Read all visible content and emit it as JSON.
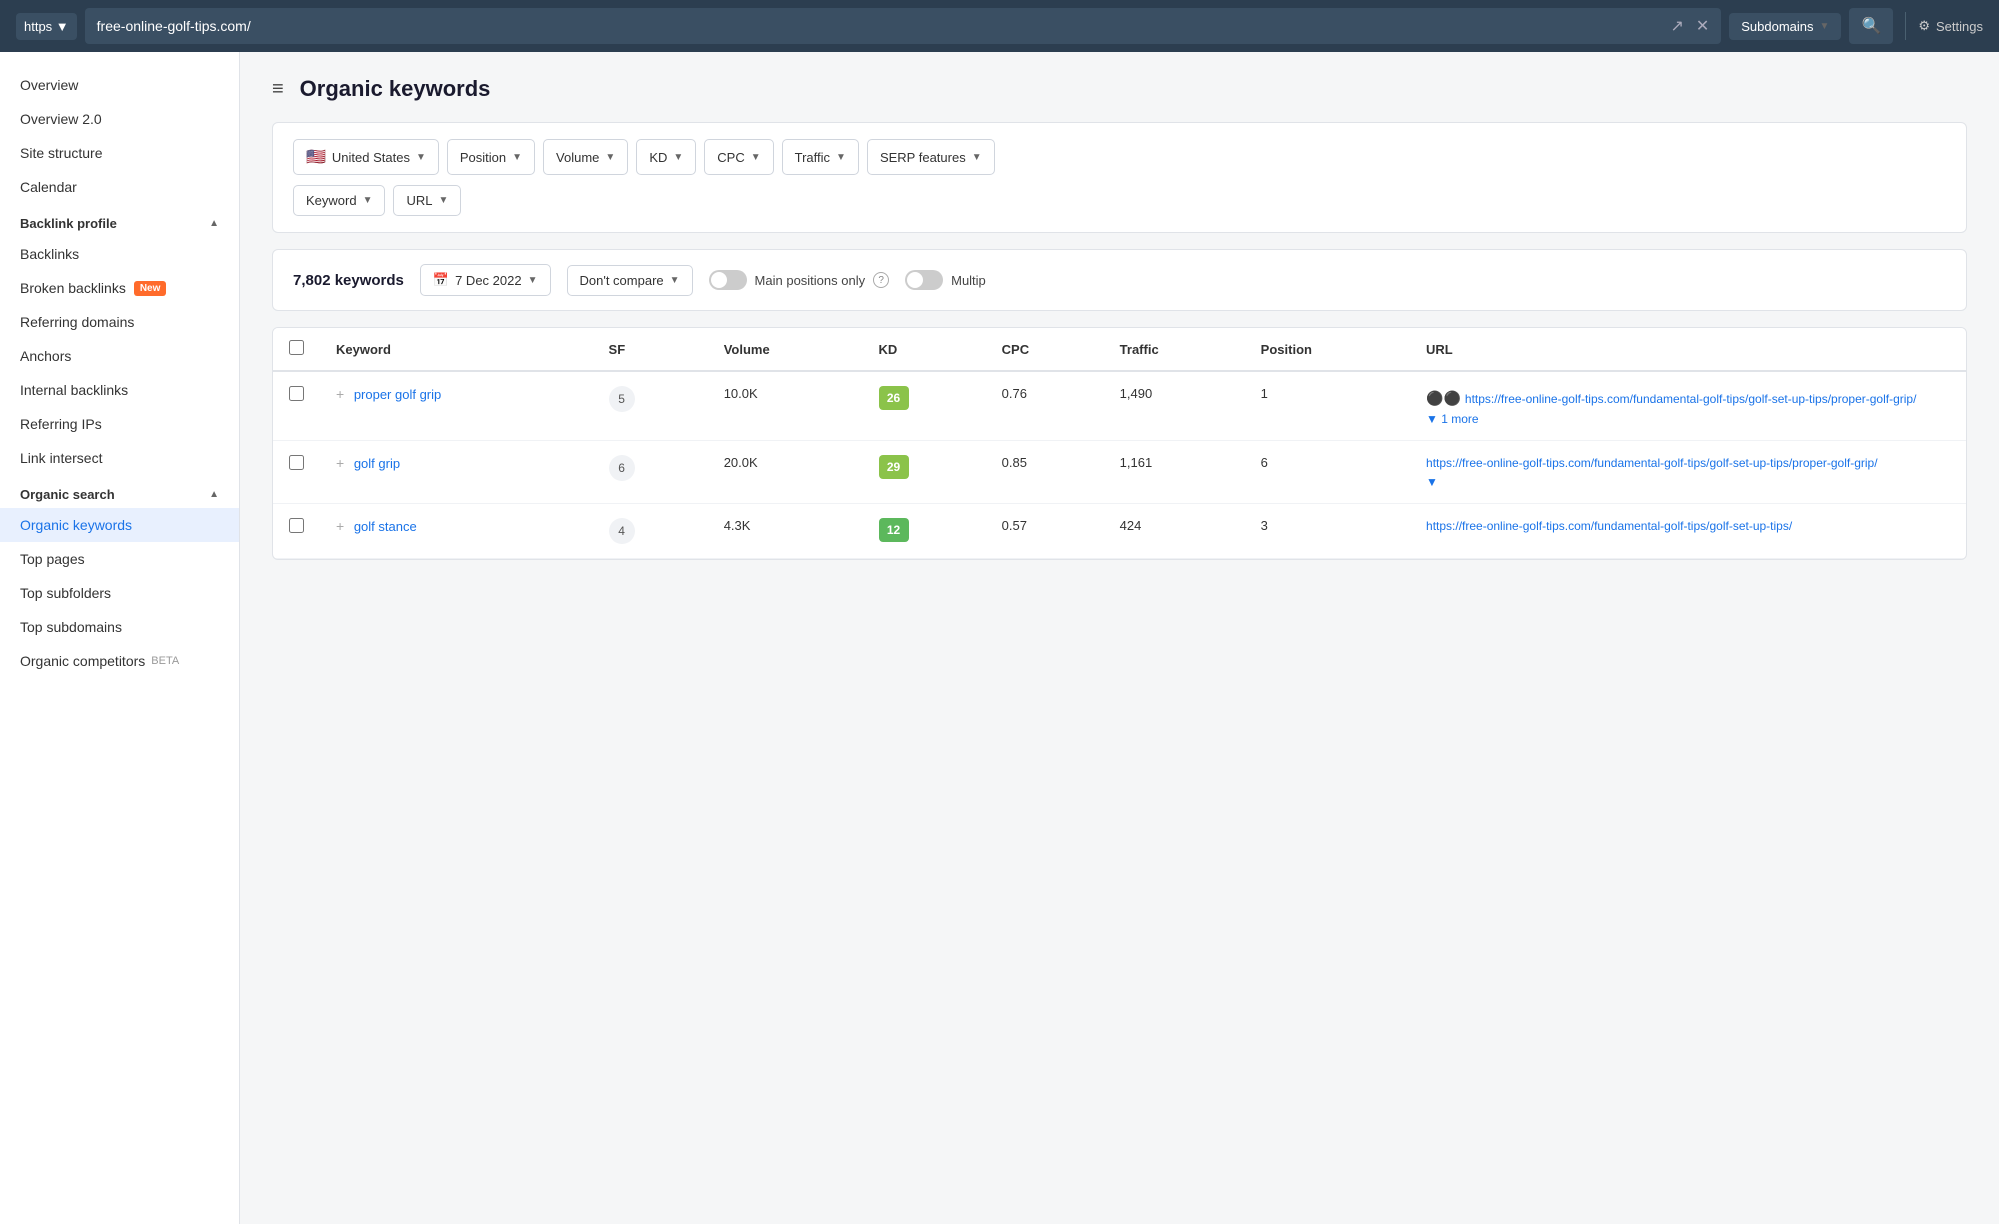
{
  "topbar": {
    "protocol": "https",
    "protocol_label": "https ▼",
    "url": "free-online-golf-tips.com/",
    "external_icon": "↗",
    "close_icon": "✕",
    "subdomain_label": "Subdomains",
    "search_icon": "🔍",
    "settings_label": "Settings"
  },
  "sidebar": {
    "top_items": [
      {
        "id": "overview",
        "label": "Overview"
      },
      {
        "id": "overview-2",
        "label": "Overview 2.0"
      },
      {
        "id": "site-structure",
        "label": "Site structure"
      },
      {
        "id": "calendar",
        "label": "Calendar"
      }
    ],
    "sections": [
      {
        "id": "backlink-profile",
        "label": "Backlink profile",
        "expanded": true,
        "items": [
          {
            "id": "backlinks",
            "label": "Backlinks",
            "badge": null
          },
          {
            "id": "broken-backlinks",
            "label": "Broken backlinks",
            "badge": "New"
          },
          {
            "id": "referring-domains",
            "label": "Referring domains",
            "badge": null
          },
          {
            "id": "anchors",
            "label": "Anchors",
            "badge": null
          },
          {
            "id": "internal-backlinks",
            "label": "Internal backlinks",
            "badge": null
          },
          {
            "id": "referring-ips",
            "label": "Referring IPs",
            "badge": null
          },
          {
            "id": "link-intersect",
            "label": "Link intersect",
            "badge": null
          }
        ]
      },
      {
        "id": "organic-search",
        "label": "Organic search",
        "expanded": true,
        "items": [
          {
            "id": "organic-keywords",
            "label": "Organic keywords",
            "badge": null,
            "active": true
          },
          {
            "id": "top-pages",
            "label": "Top pages",
            "badge": null
          },
          {
            "id": "top-subfolders",
            "label": "Top subfolders",
            "badge": null
          },
          {
            "id": "top-subdomains",
            "label": "Top subdomains",
            "badge": null
          },
          {
            "id": "organic-competitors",
            "label": "Organic competitors",
            "badge": "BETA"
          }
        ]
      }
    ]
  },
  "page": {
    "menu_icon": "≡",
    "title": "Organic keywords"
  },
  "filters": {
    "row1": [
      {
        "id": "country",
        "flag": "🇺🇸",
        "label": "United States",
        "has_dropdown": true
      },
      {
        "id": "position",
        "label": "Position",
        "has_dropdown": true
      },
      {
        "id": "volume",
        "label": "Volume",
        "has_dropdown": true
      },
      {
        "id": "kd",
        "label": "KD",
        "has_dropdown": true
      },
      {
        "id": "cpc",
        "label": "CPC",
        "has_dropdown": true
      },
      {
        "id": "traffic",
        "label": "Traffic",
        "has_dropdown": true
      },
      {
        "id": "serp-features",
        "label": "SERP features",
        "has_dropdown": true
      }
    ],
    "row2": [
      {
        "id": "keyword",
        "label": "Keyword",
        "has_dropdown": true
      },
      {
        "id": "url",
        "label": "URL",
        "has_dropdown": true
      }
    ]
  },
  "toolbar": {
    "keywords_count": "7,802 keywords",
    "date_icon": "📅",
    "date_label": "7 Dec 2022",
    "compare_label": "Don't compare",
    "main_positions_label": "Main positions only",
    "multi_label": "Multip"
  },
  "table": {
    "columns": [
      {
        "id": "checkbox",
        "label": ""
      },
      {
        "id": "keyword",
        "label": "Keyword"
      },
      {
        "id": "sf",
        "label": "SF"
      },
      {
        "id": "volume",
        "label": "Volume"
      },
      {
        "id": "kd",
        "label": "KD"
      },
      {
        "id": "cpc",
        "label": "CPC"
      },
      {
        "id": "traffic",
        "label": "Traffic"
      },
      {
        "id": "position",
        "label": "Position"
      },
      {
        "id": "url",
        "label": "URL"
      }
    ],
    "rows": [
      {
        "id": "row-1",
        "keyword": "proper golf grip",
        "sf": "5",
        "volume": "10.0K",
        "kd": "26",
        "kd_color": "light-green",
        "cpc": "0.76",
        "traffic": "1,490",
        "position": "1",
        "url_main": "https://free-online-golf-tips.com/fundamental-golf-tips/golf-set-up-tips/proper-golf-grip/",
        "url_more": "▼ 1 more",
        "has_dots": true
      },
      {
        "id": "row-2",
        "keyword": "golf grip",
        "sf": "6",
        "volume": "20.0K",
        "kd": "29",
        "kd_color": "light-green",
        "cpc": "0.85",
        "traffic": "1,161",
        "position": "6",
        "url_main": "https://free-online-golf-tips.com/fundamental-golf-tips/golf-set-up-tips/proper-golf-grip/",
        "url_more": "▼",
        "has_dots": false
      },
      {
        "id": "row-3",
        "keyword": "golf stance",
        "sf": "4",
        "volume": "4.3K",
        "kd": "12",
        "kd_color": "green",
        "cpc": "0.57",
        "traffic": "424",
        "position": "3",
        "url_main": "https://free-online-golf-tips.com/fundamental-golf-tips/golf-set-up-tips/",
        "url_more": "",
        "has_dots": false
      }
    ]
  }
}
